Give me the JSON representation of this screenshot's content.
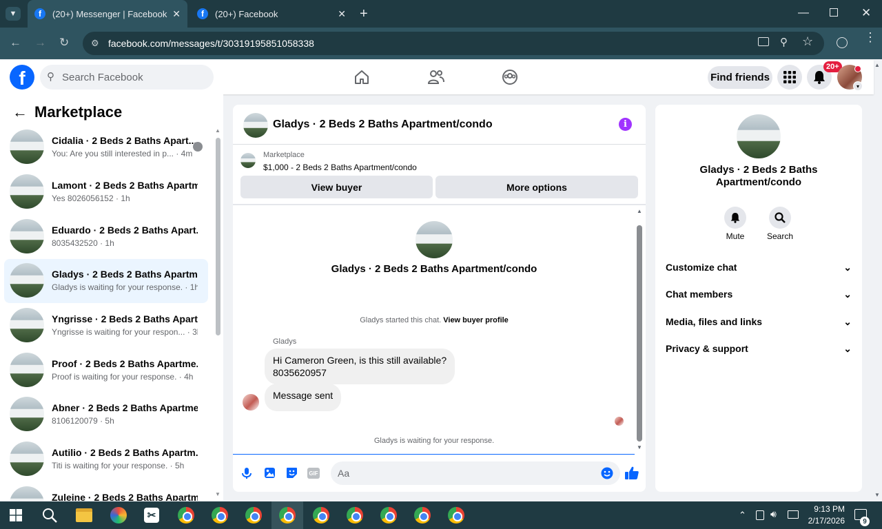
{
  "browser": {
    "tabs": [
      {
        "title": "(20+) Messenger | Facebook"
      },
      {
        "title": "(20+) Facebook"
      }
    ],
    "url": "facebook.com/messages/t/30319195851058338"
  },
  "fb_header": {
    "logo": "f",
    "search_placeholder": "Search Facebook",
    "find_friends": "Find friends",
    "notif_count": "20+"
  },
  "sidebar": {
    "title": "Marketplace",
    "conversations": [
      {
        "name": "Cidalia · 2 Beds 2 Baths Apart...",
        "preview": "You: Are you still interested in p... · 4m"
      },
      {
        "name": "Lamont · 2 Beds 2 Baths Apartm...",
        "preview": "Yes 8026056152 · 1h"
      },
      {
        "name": "Eduardo · 2 Beds 2 Baths Apart...",
        "preview": "8035432520 · 1h"
      },
      {
        "name": "Gladys · 2 Beds 2 Baths Apartm...",
        "preview": "Gladys is waiting for your response. · 1h"
      },
      {
        "name": "Yngrisse · 2 Beds 2 Baths Apart...",
        "preview": "Yngrisse is waiting for your respon...  · 3h"
      },
      {
        "name": "Proof · 2 Beds 2 Baths Apartme...",
        "preview": "Proof is waiting for your response. · 4h"
      },
      {
        "name": "Abner · 2 Beds 2 Baths Apartme...",
        "preview": "8106120079 · 5h"
      },
      {
        "name": "Autilio · 2 Beds 2 Baths Apartm...",
        "preview": "Titi is waiting for your response. · 5h"
      },
      {
        "name": "Zuleine · 2 Beds 2 Baths Apartm...",
        "preview": ""
      }
    ]
  },
  "chat": {
    "title": "Gladys · 2 Beds 2 Baths Apartment/condo",
    "listing_source": "Marketplace",
    "listing": "$1,000 - 2 Beds 2 Baths Apartment/condo",
    "view_buyer": "View buyer",
    "more_options": "More options",
    "intro_name": "Gladys · 2 Beds 2 Baths Apartment/condo",
    "started_text": "Gladys started this chat.",
    "buyer_profile_link": "View buyer profile",
    "sender": "Gladys",
    "msg1_line1": "Hi Cameron Green, is this still available?",
    "msg1_line2": "8035620957",
    "msg2": "Message sent",
    "waiting": "Gladys is waiting for your response.",
    "composer_placeholder": "Aa"
  },
  "details": {
    "name": "Gladys · 2 Beds 2 Baths Apartment/condo",
    "mute": "Mute",
    "search": "Search",
    "sections": [
      "Customize chat",
      "Chat members",
      "Media, files and links",
      "Privacy & support"
    ]
  },
  "taskbar": {
    "time": "9:13 PM",
    "date": "2/17/2026",
    "notif_count": "9"
  },
  "colors": {
    "accent": "#0866ff",
    "badge": "#e41e3f",
    "chrome_dark": "#1f3a42"
  }
}
